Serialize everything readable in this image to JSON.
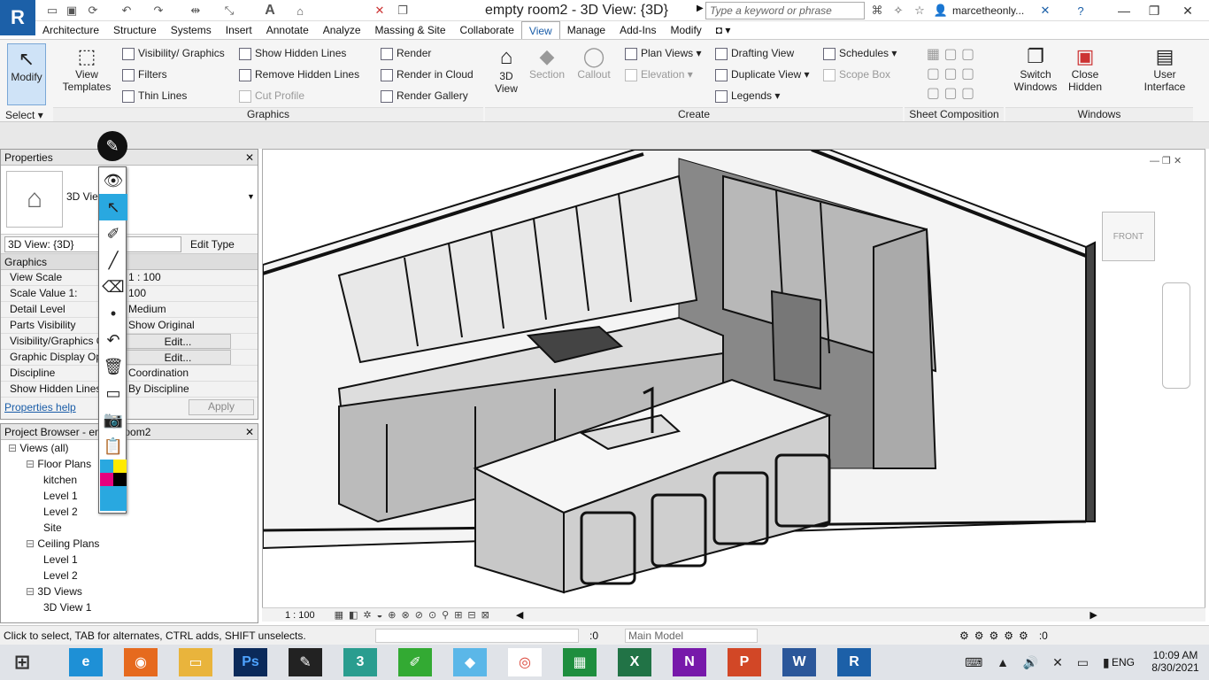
{
  "app": {
    "logo": "R",
    "title": "empty room2 - 3D View: {3D}",
    "search_placeholder": "Type a keyword or phrase",
    "user": "marcetheonly..."
  },
  "tabs": [
    "Architecture",
    "Structure",
    "Systems",
    "Insert",
    "Annotate",
    "Analyze",
    "Massing & Site",
    "Collaborate",
    "View",
    "Manage",
    "Add-Ins",
    "Modify"
  ],
  "active_tab": "View",
  "ribbon": {
    "modify": "Modify",
    "select": "Select",
    "view_templates": "View Templates",
    "visibility_graphics": "Visibility/ Graphics",
    "filters": "Filters",
    "thin_lines": "Thin Lines",
    "show_hidden": "Show Hidden Lines",
    "remove_hidden": "Remove Hidden Lines",
    "cut_profile": "Cut Profile",
    "render": "Render",
    "render_cloud": "Render in Cloud",
    "render_gallery": "Render Gallery",
    "graphics_panel": "Graphics",
    "view3d": "3D View",
    "section": "Section",
    "callout": "Callout",
    "plan_views": "Plan Views",
    "elevation": "Elevation",
    "drafting_view": "Drafting View",
    "duplicate_view": "Duplicate View",
    "legends": "Legends",
    "schedules": "Schedules",
    "scope_box": "Scope Box",
    "create_panel": "Create",
    "sheet_panel": "Sheet Composition",
    "switch_windows": "Switch Windows",
    "close_hidden": "Close Hidden",
    "user_interface": "User Interface",
    "windows_panel": "Windows"
  },
  "properties": {
    "title": "Properties",
    "type_name": "3D View",
    "selector": "3D View: {3D}",
    "edit_type": "Edit Type",
    "section": "Graphics",
    "rows": [
      {
        "k": "View Scale",
        "v": "1 : 100"
      },
      {
        "k": "Scale Value  1:",
        "v": "100"
      },
      {
        "k": "Detail Level",
        "v": "Medium"
      },
      {
        "k": "Parts Visibility",
        "v": "Show Original"
      },
      {
        "k": "Visibility/Graphics O...",
        "v": "Edit..."
      },
      {
        "k": "Graphic Display Opt...",
        "v": "Edit..."
      },
      {
        "k": "Discipline",
        "v": "Coordination"
      },
      {
        "k": "Show Hidden Lines",
        "v": "By Discipline"
      }
    ],
    "help": "Properties help",
    "apply": "Apply"
  },
  "browser": {
    "title": "Project Browser - empty room2",
    "items": [
      {
        "t": "Views (all)",
        "lvl": 0
      },
      {
        "t": "Floor Plans",
        "lvl": 1
      },
      {
        "t": "kitchen",
        "lvl": 2
      },
      {
        "t": "Level 1",
        "lvl": 2
      },
      {
        "t": "Level 2",
        "lvl": 2
      },
      {
        "t": "Site",
        "lvl": 2
      },
      {
        "t": "Ceiling Plans",
        "lvl": 1
      },
      {
        "t": "Level 1",
        "lvl": 2
      },
      {
        "t": "Level 2",
        "lvl": 2
      },
      {
        "t": "3D Views",
        "lvl": 1
      },
      {
        "t": "3D View 1",
        "lvl": 2
      }
    ]
  },
  "viewbar": {
    "scale": "1 : 100"
  },
  "status": {
    "text": "Click to select, TAB for alternates, CTRL adds, SHIFT unselects.",
    "count": ":0",
    "model": "Main Model",
    "filter": ":0"
  },
  "taskbar": {
    "lang": "ENG",
    "time": "10:09 AM",
    "date": "8/30/2021"
  }
}
